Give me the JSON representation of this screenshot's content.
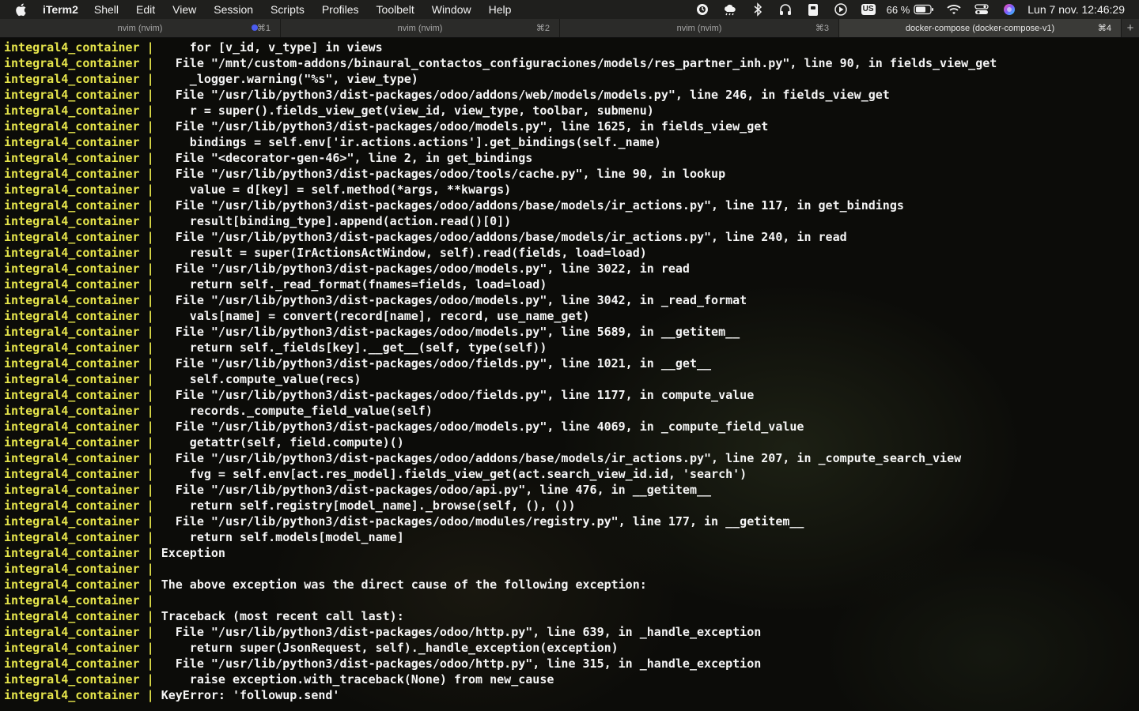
{
  "menubar": {
    "app_name": "iTerm2",
    "menus": [
      "Shell",
      "Edit",
      "View",
      "Session",
      "Scripts",
      "Profiles",
      "Toolbelt",
      "Window",
      "Help"
    ],
    "status": {
      "keyboard_layout": "US",
      "battery": "66 %",
      "datetime": "Lun 7 nov.  12:46:29"
    }
  },
  "tabs": [
    {
      "title": "nvim (nvim)",
      "shortcut": "⌘1",
      "active": false,
      "dot": true
    },
    {
      "title": "nvim (nvim)",
      "shortcut": "⌘2",
      "active": false,
      "dot": false
    },
    {
      "title": "nvim (nvim)",
      "shortcut": "⌘3",
      "active": false,
      "dot": false
    },
    {
      "title": "docker-compose (docker-compose-v1)",
      "shortcut": "⌘4",
      "active": true,
      "dot": false
    }
  ],
  "terminal": {
    "prefix": "integral4_container | ",
    "lines": [
      "    for [v_id, v_type] in views",
      "  File \"/mnt/custom-addons/binaural_contactos_configuraciones/models/res_partner_inh.py\", line 90, in fields_view_get",
      "    _logger.warning(\"%s\", view_type)",
      "  File \"/usr/lib/python3/dist-packages/odoo/addons/web/models/models.py\", line 246, in fields_view_get",
      "    r = super().fields_view_get(view_id, view_type, toolbar, submenu)",
      "  File \"/usr/lib/python3/dist-packages/odoo/models.py\", line 1625, in fields_view_get",
      "    bindings = self.env['ir.actions.actions'].get_bindings(self._name)",
      "  File \"<decorator-gen-46>\", line 2, in get_bindings",
      "  File \"/usr/lib/python3/dist-packages/odoo/tools/cache.py\", line 90, in lookup",
      "    value = d[key] = self.method(*args, **kwargs)",
      "  File \"/usr/lib/python3/dist-packages/odoo/addons/base/models/ir_actions.py\", line 117, in get_bindings",
      "    result[binding_type].append(action.read()[0])",
      "  File \"/usr/lib/python3/dist-packages/odoo/addons/base/models/ir_actions.py\", line 240, in read",
      "    result = super(IrActionsActWindow, self).read(fields, load=load)",
      "  File \"/usr/lib/python3/dist-packages/odoo/models.py\", line 3022, in read",
      "    return self._read_format(fnames=fields, load=load)",
      "  File \"/usr/lib/python3/dist-packages/odoo/models.py\", line 3042, in _read_format",
      "    vals[name] = convert(record[name], record, use_name_get)",
      "  File \"/usr/lib/python3/dist-packages/odoo/models.py\", line 5689, in __getitem__",
      "    return self._fields[key].__get__(self, type(self))",
      "  File \"/usr/lib/python3/dist-packages/odoo/fields.py\", line 1021, in __get__",
      "    self.compute_value(recs)",
      "  File \"/usr/lib/python3/dist-packages/odoo/fields.py\", line 1177, in compute_value",
      "    records._compute_field_value(self)",
      "  File \"/usr/lib/python3/dist-packages/odoo/models.py\", line 4069, in _compute_field_value",
      "    getattr(self, field.compute)()",
      "  File \"/usr/lib/python3/dist-packages/odoo/addons/base/models/ir_actions.py\", line 207, in _compute_search_view",
      "    fvg = self.env[act.res_model].fields_view_get(act.search_view_id.id, 'search')",
      "  File \"/usr/lib/python3/dist-packages/odoo/api.py\", line 476, in __getitem__",
      "    return self.registry[model_name]._browse(self, (), ())",
      "  File \"/usr/lib/python3/dist-packages/odoo/modules/registry.py\", line 177, in __getitem__",
      "    return self.models[model_name]",
      "Exception",
      "",
      "The above exception was the direct cause of the following exception:",
      "",
      "Traceback (most recent call last):",
      "  File \"/usr/lib/python3/dist-packages/odoo/http.py\", line 639, in _handle_exception",
      "    return super(JsonRequest, self)._handle_exception(exception)",
      "  File \"/usr/lib/python3/dist-packages/odoo/http.py\", line 315, in _handle_exception",
      "    raise exception.with_traceback(None) from new_cause",
      "KeyError: 'followup.send'"
    ]
  },
  "colors": {
    "prefix": "#e6e54b",
    "text": "#f5f5f5",
    "active_tab_dot": "#4b5cf0"
  }
}
